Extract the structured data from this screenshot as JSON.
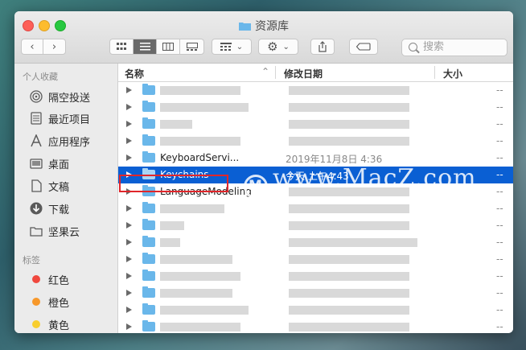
{
  "window": {
    "title": "资源库"
  },
  "toolbar": {
    "search_placeholder": "搜索"
  },
  "sidebar": {
    "favorites_header": "个人收藏",
    "favorites": [
      {
        "label": "隔空投送",
        "icon": "airdrop-icon"
      },
      {
        "label": "最近项目",
        "icon": "recents-icon"
      },
      {
        "label": "应用程序",
        "icon": "applications-icon"
      },
      {
        "label": "桌面",
        "icon": "desktop-icon"
      },
      {
        "label": "文稿",
        "icon": "documents-icon"
      },
      {
        "label": "下载",
        "icon": "downloads-icon"
      },
      {
        "label": "坚果云",
        "icon": "folder-icon"
      }
    ],
    "tags_header": "标签",
    "tags": [
      {
        "label": "红色",
        "color": "#f0483e"
      },
      {
        "label": "橙色",
        "color": "#f7982a"
      },
      {
        "label": "黄色",
        "color": "#f8ce2e"
      }
    ]
  },
  "columns": {
    "name": "名称",
    "date": "修改日期",
    "size": "大小"
  },
  "rows": [
    {
      "name": "",
      "date": "",
      "size": "--"
    },
    {
      "name": "",
      "date": "",
      "size": "--"
    },
    {
      "name": "",
      "date": "",
      "size": "--"
    },
    {
      "name": "",
      "date": "",
      "size": "--"
    },
    {
      "name": "KeyboardServi...",
      "date": "2019年11月8日 4:36",
      "size": "--"
    },
    {
      "name": "Keychains",
      "date": "今天 上午4:43",
      "size": "--",
      "selected": true
    },
    {
      "name": "LanguageModeling",
      "date": "",
      "size": "--"
    },
    {
      "name": "",
      "date": "",
      "size": "--"
    },
    {
      "name": "",
      "date": "",
      "size": "--"
    },
    {
      "name": "",
      "date": "",
      "size": "--"
    },
    {
      "name": "",
      "date": "",
      "size": "--"
    },
    {
      "name": "",
      "date": "",
      "size": "--"
    },
    {
      "name": "",
      "date": "",
      "size": "--"
    },
    {
      "name": "",
      "date": "",
      "size": "--"
    },
    {
      "name": "",
      "date": "",
      "size": "--"
    }
  ],
  "watermark": "www.MacZ.com"
}
